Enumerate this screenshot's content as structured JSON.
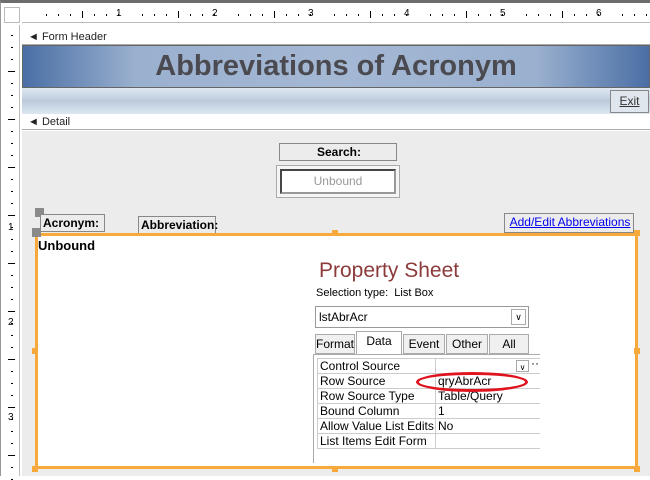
{
  "ruler": {
    "h_numbers": [
      "1",
      "2",
      "3",
      "4",
      "5",
      "6"
    ],
    "v_numbers": [
      "1",
      "2",
      "3"
    ]
  },
  "sections": {
    "form_header": "Form Header",
    "detail": "Detail"
  },
  "header": {
    "title": "Abbreviations of Acronym",
    "exit_label": "Exit"
  },
  "detail": {
    "search_label": "Search:",
    "search_box_value": "Unbound",
    "acronym_label": "Acronym:",
    "abbreviation_label": "Abbreviation:",
    "add_edit_link": "Add/Edit Abbreviations",
    "listbox_value": "Unbound"
  },
  "property_sheet": {
    "title": "Property Sheet",
    "selection_type_label": "Selection type:",
    "selection_type": "List Box",
    "selected_object": "lstAbrAcr",
    "tabs": [
      "Format",
      "Data",
      "Event",
      "Other",
      "All"
    ],
    "active_tab": "Data",
    "rows": [
      {
        "name": "Control Source",
        "value": ""
      },
      {
        "name": "Row Source",
        "value": "qryAbrAcr"
      },
      {
        "name": "Row Source Type",
        "value": "Table/Query"
      },
      {
        "name": "Bound Column",
        "value": "1"
      },
      {
        "name": "Allow Value List Edits",
        "value": "No"
      },
      {
        "name": "List Items Edit Form",
        "value": ""
      }
    ],
    "highlight_color": "#e0141e"
  }
}
